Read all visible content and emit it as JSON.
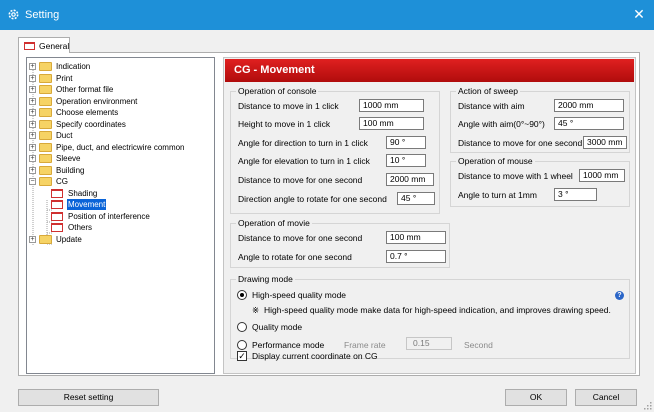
{
  "window": {
    "title": "Setting",
    "close_glyph": "✕",
    "accent": "#1e90d8"
  },
  "tab": {
    "label": "General"
  },
  "tree": {
    "items": [
      {
        "label": "Indication",
        "icon": "folder-icon"
      },
      {
        "label": "Print",
        "icon": "folder-icon"
      },
      {
        "label": "Other format file",
        "icon": "folder-icon"
      },
      {
        "label": "Operation environment",
        "icon": "folder-icon"
      },
      {
        "label": "Choose elements",
        "icon": "folder-icon"
      },
      {
        "label": "Specify coordinates",
        "icon": "folder-icon"
      },
      {
        "label": "Duct",
        "icon": "folder-icon"
      },
      {
        "label": "Pipe, duct, and electricwire common",
        "icon": "folder-icon"
      },
      {
        "label": "Sleeve",
        "icon": "folder-icon"
      },
      {
        "label": "Building",
        "icon": "folder-icon"
      },
      {
        "label": "CG",
        "icon": "folder-icon",
        "expanded": true
      },
      {
        "label": "Shading",
        "icon": "page-icon"
      },
      {
        "label": "Movement",
        "icon": "page-icon",
        "selected": true
      },
      {
        "label": "Position of interference",
        "icon": "page-icon"
      },
      {
        "label": "Others",
        "icon": "page-icon"
      },
      {
        "label": "Update",
        "icon": "folder-icon"
      }
    ]
  },
  "panel": {
    "header": "CG - Movement",
    "header_color": "#c81414",
    "console": {
      "title": "Operation of console",
      "rows": [
        {
          "label": "Distance to move in 1 click",
          "value": "1000 mm"
        },
        {
          "label": "Height to move in 1 click",
          "value": "100 mm"
        },
        {
          "label": "Angle for direction to turn in 1 click",
          "value": "90 °"
        },
        {
          "label": "Angle for elevation to turn in 1 click",
          "value": "10 °"
        },
        {
          "label": "Distance to move for one second",
          "value": "2000 mm"
        },
        {
          "label": "Direction angle to rotate for one second",
          "value": "45 °"
        }
      ]
    },
    "sweep": {
      "title": "Action of sweep",
      "rows": [
        {
          "label": "Distance with aim",
          "value": "2000 mm"
        },
        {
          "label": "Angle with aim(0°~90°)",
          "value": "45 °"
        },
        {
          "label": "Distance to move for one second",
          "value": "3000 mm"
        }
      ]
    },
    "mouse": {
      "title": "Operation of mouse",
      "rows": [
        {
          "label": "Distance to move with 1 wheel",
          "value": "1000 mm"
        },
        {
          "label": "Angle to turn at 1mm",
          "value": "3 °"
        }
      ]
    },
    "movie": {
      "title": "Operation of movie",
      "rows": [
        {
          "label": "Distance to move for one second",
          "value": "100 mm"
        },
        {
          "label": "Angle to rotate for one second",
          "value": "0.7 °"
        }
      ]
    },
    "drawing": {
      "title": "Drawing mode",
      "high_speed": "High-speed quality mode",
      "note_mark": "※",
      "note": "High-speed quality mode make data for high-speed indication, and improves drawing speed.",
      "quality": "Quality mode",
      "performance": "Performance mode",
      "frame_rate_label": "Frame rate",
      "frame_rate_value": "0.15",
      "frame_rate_unit": "Second",
      "help_glyph": "?"
    },
    "display_coord": {
      "label": "Display current coordinate on CG",
      "checked": true,
      "check_glyph": "✓"
    }
  },
  "buttons": {
    "reset": "Reset setting",
    "ok": "OK",
    "cancel": "Cancel"
  }
}
